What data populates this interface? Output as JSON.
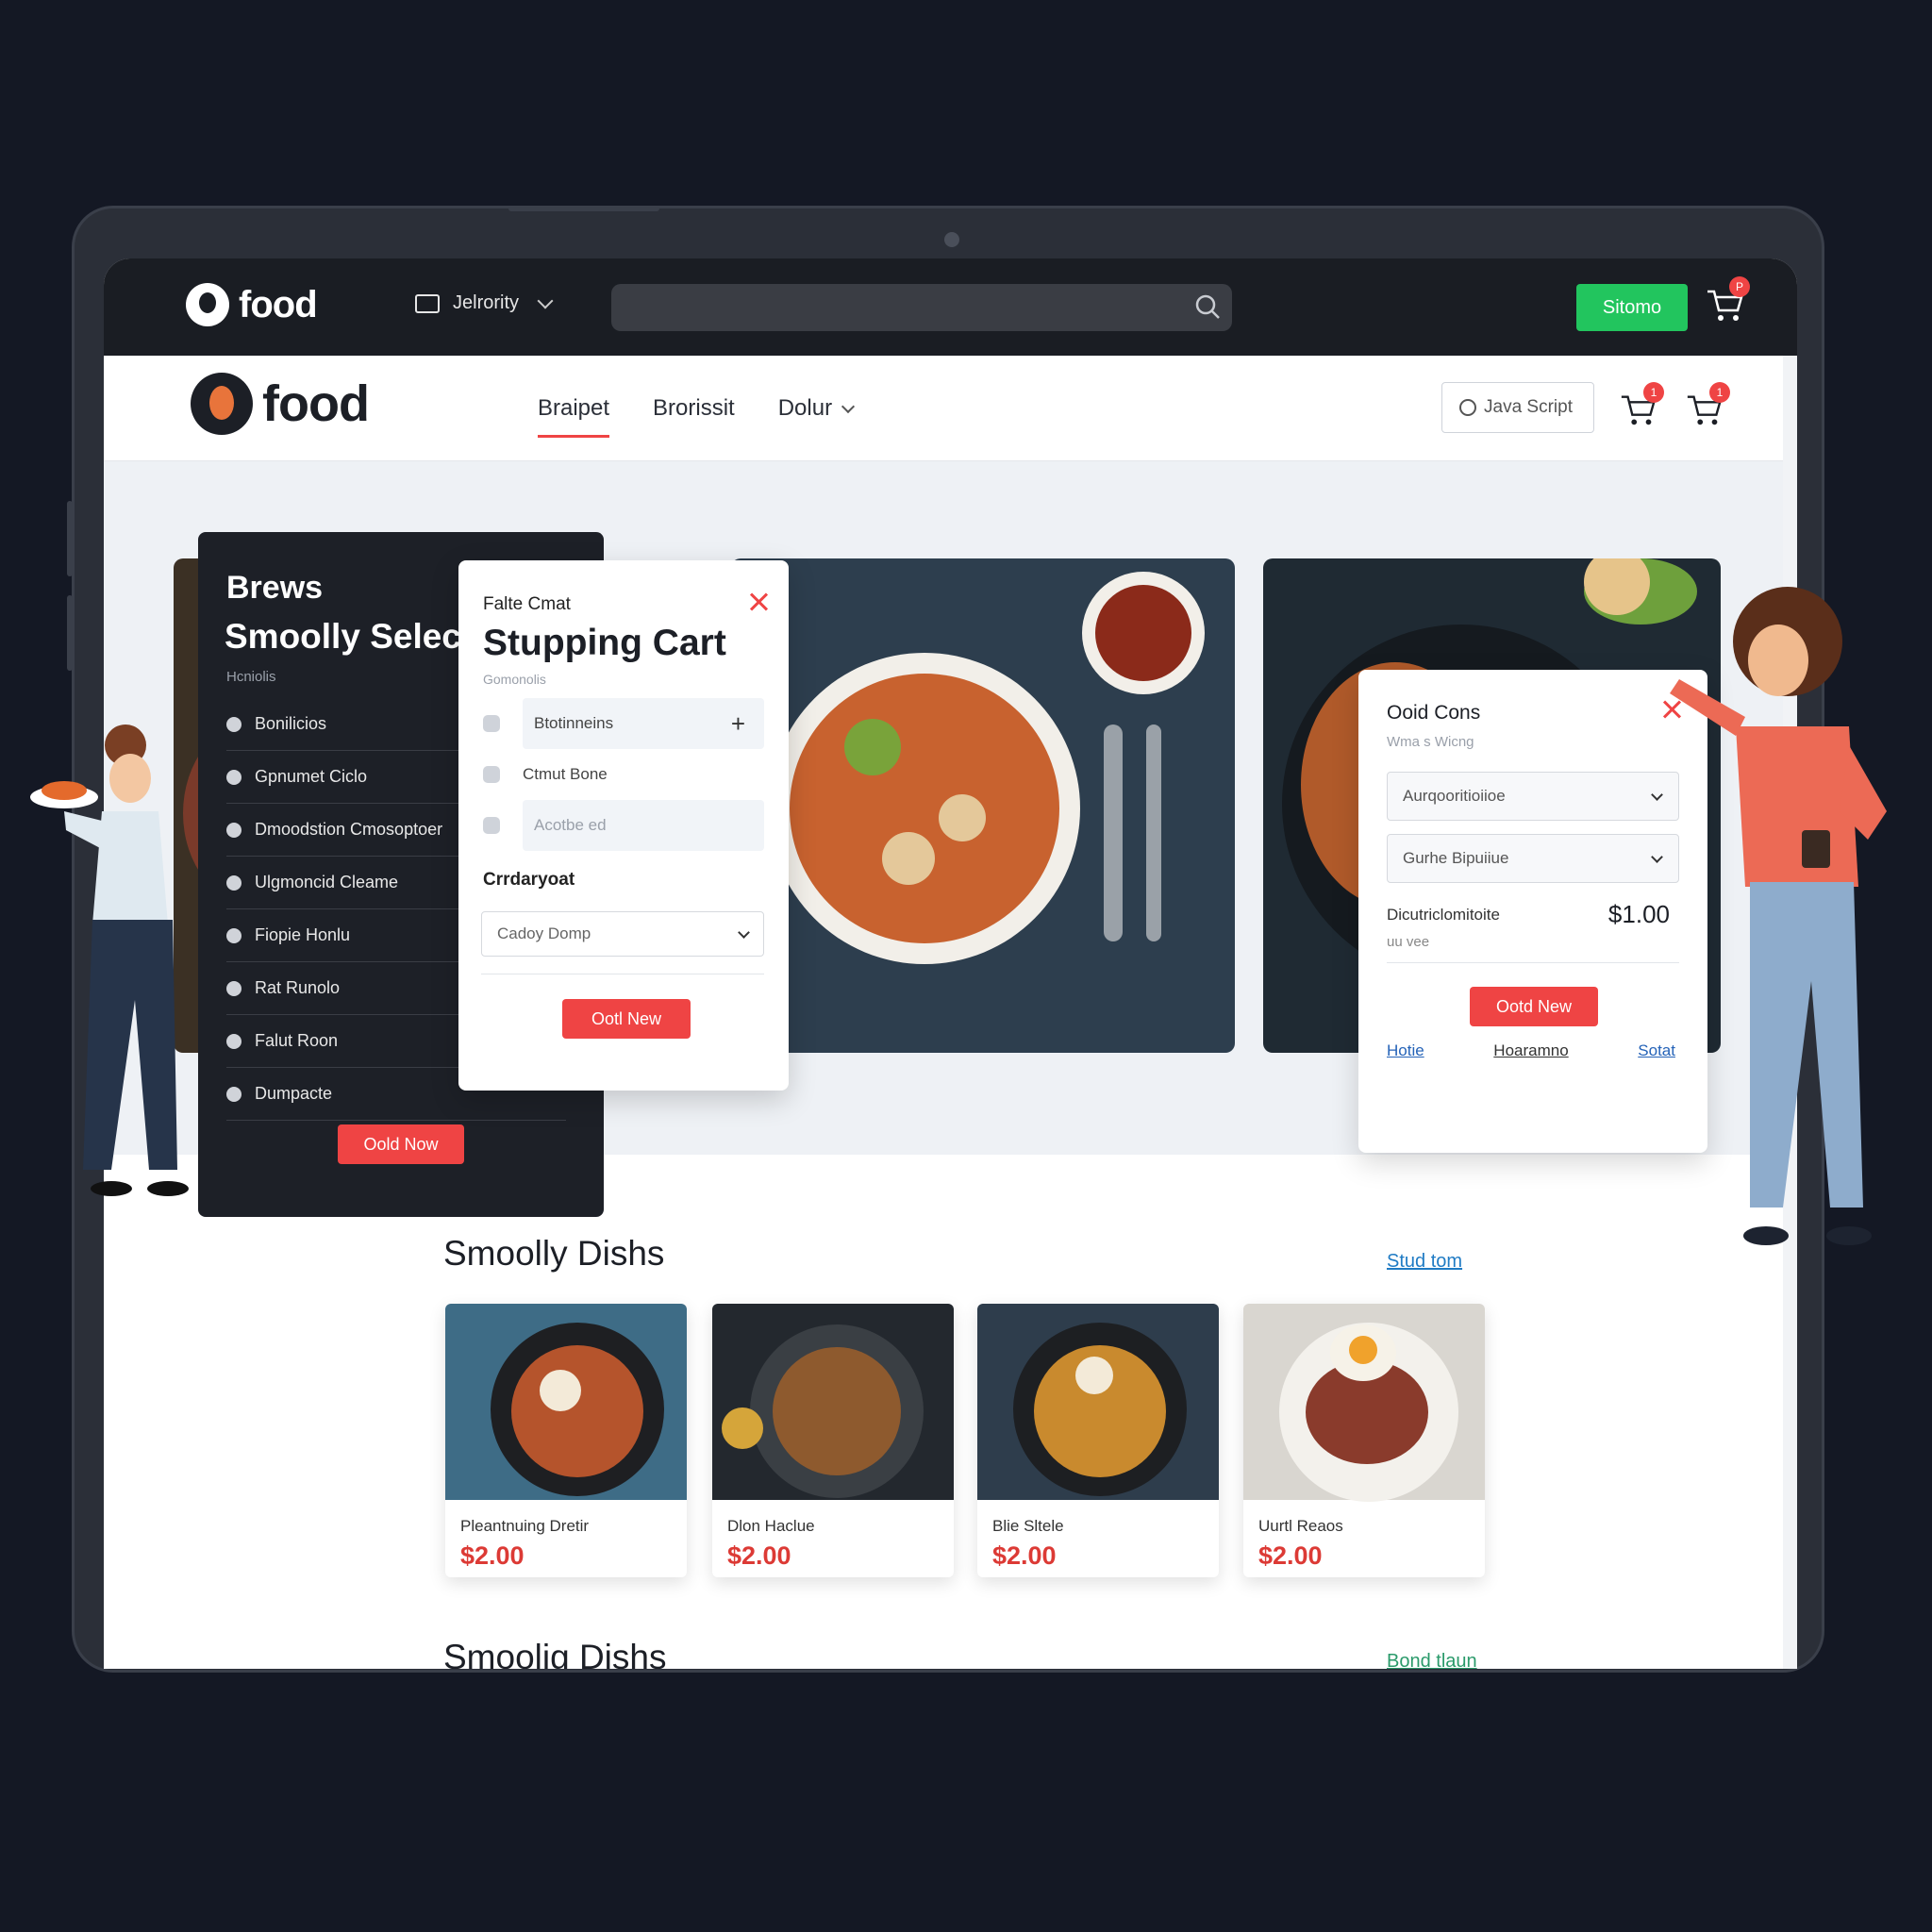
{
  "topbar": {
    "logo_text": "food",
    "location_label": "Jelrority",
    "cta_label": "Sitomo",
    "cart_badge": "P"
  },
  "nav": {
    "logo_text": "food",
    "links": [
      {
        "label": "Braipet"
      },
      {
        "label": "Brorissit"
      },
      {
        "label": "Dolur"
      }
    ],
    "search_placeholder": "Java Script",
    "cart_badges": [
      "1",
      "1"
    ]
  },
  "brews_panel": {
    "title": "Brews",
    "heading": "Smoolly Select",
    "subtitle": "Hcniolis",
    "items": [
      "Bonilicios",
      "Gpnumet Ciclo",
      "Dmoodstion Cmosoptoer",
      "Ulgmoncid Cleame",
      "Fiopie Honlu",
      "Rat Runolo",
      "Falut Roon",
      "Dumpacte"
    ],
    "button": "Oold Now"
  },
  "cart": {
    "eyebrow": "Falte Cmat",
    "title": "Stupping Cart",
    "caption": "Gomonolis",
    "rows": [
      "Btotinneins",
      "Ctmut Bone",
      "Acotbe ed"
    ],
    "section_label": "Crrdaryoat",
    "select_value": "Cadoy Domp",
    "button": "Ootl New"
  },
  "order_card": {
    "title": "Ooid Cons",
    "subtitle": "Wma s Wicng",
    "select_1": "Aurqooritioiioe",
    "select_2": "Gurhe Bipuiiue",
    "price_label": "Dicutriclomitoite",
    "price_value": "$1.00",
    "price_sub": "uu vee",
    "button": "Ootd New",
    "links": [
      "Hotie",
      "Hoaramno",
      "Sotat"
    ]
  },
  "dishes_section": {
    "title": "Smoolly Dishs",
    "link": "Stud tom",
    "items": [
      {
        "name": "Pleantnuing Dretir",
        "price": "$2.00"
      },
      {
        "name": "Dlon Haclue",
        "price": "$2.00"
      },
      {
        "name": "Blie Sltele",
        "price": "$2.00"
      },
      {
        "name": "Uurtl Reaos",
        "price": "$2.00"
      }
    ]
  },
  "second_section": {
    "title": "Smoolig Dishs",
    "link": "Bond tlaun"
  },
  "colors": {
    "accent_red": "#ef4444",
    "accent_green": "#22c55e",
    "dark": "#1d2027",
    "link_blue": "#2563b8"
  }
}
